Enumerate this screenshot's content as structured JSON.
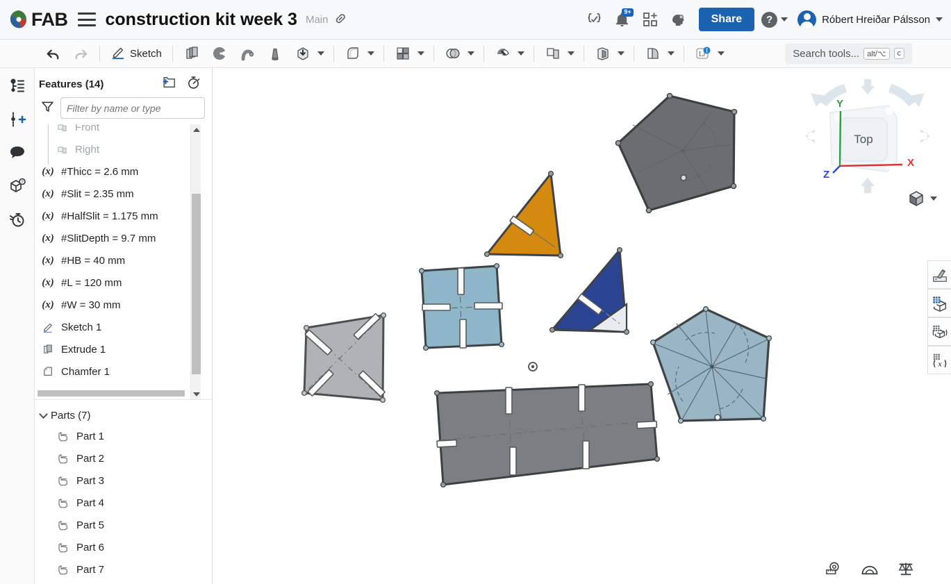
{
  "header": {
    "logo_text": "FAB",
    "logo_icon": "fab-logo-icon",
    "menu_icon": "hamburger-menu-icon",
    "document_title": "construction kit week 3",
    "branch": "Main",
    "link_icon": "link-icon",
    "icons": [
      {
        "name": "feature-script-icon",
        "glyph": "{✓}"
      },
      {
        "name": "notifications-bell-icon",
        "glyph": "🔔",
        "badge": "9+"
      },
      {
        "name": "apps-grid-icon",
        "glyph": "grid-plus"
      },
      {
        "name": "learning-center-icon",
        "glyph": "brain"
      }
    ],
    "share_label": "Share",
    "help_icon": "help-question-icon",
    "help_caret_icon": "chevron-down-icon",
    "avatar_icon": "user-avatar",
    "user_name": "Róbert Hreiðar Pálsson",
    "user_caret_icon": "chevron-down-icon"
  },
  "toolbar": {
    "undo_icon": "undo-arrow-icon",
    "redo_icon": "redo-arrow-icon",
    "sketch_label": "Sketch",
    "sketch_icon": "pencil-sketch-icon",
    "tools": [
      {
        "name": "extrude-icon",
        "caret": false
      },
      {
        "name": "revolve-icon",
        "caret": false
      },
      {
        "name": "sweep-icon",
        "caret": false
      },
      {
        "name": "loft-icon",
        "caret": false
      },
      {
        "name": "thicken-icon",
        "caret": true
      },
      {
        "name": "fillet-icon",
        "caret": true
      },
      {
        "name": "pattern-icon",
        "caret": true
      },
      {
        "name": "boolean-icon",
        "caret": true
      },
      {
        "name": "draft-icon",
        "caret": true
      },
      {
        "name": "plane-icon",
        "caret": true
      },
      {
        "name": "shell-icon",
        "caret": true
      },
      {
        "name": "sheet-metal-icon",
        "caret": true
      },
      {
        "name": "variable-studio-icon",
        "caret": true
      }
    ],
    "search_placeholder": "Search tools...",
    "shortcut_alt": "alt/⌥",
    "shortcut_key": "c"
  },
  "rail": {
    "items": [
      {
        "name": "feature-list-icon"
      },
      {
        "name": "add-variable-icon"
      },
      {
        "name": "comments-icon"
      },
      {
        "name": "versions-icon"
      },
      {
        "name": "history-icon"
      }
    ]
  },
  "panel": {
    "features_title": "Features (14)",
    "new_folder_icon": "new-folder-icon",
    "rollback_icon": "rollback-stopwatch-icon",
    "filter_icon": "funnel-filter-icon",
    "filter_placeholder": "Filter by name or type",
    "filter_value": "",
    "features": [
      {
        "label": "Front",
        "icon": "plane-icon",
        "dim": true
      },
      {
        "label": "Right",
        "icon": "plane-icon",
        "dim": true
      },
      {
        "label": "#Thicc = 2.6 mm",
        "icon": "variable-icon",
        "dim": false
      },
      {
        "label": "#Slit = 2.35 mm",
        "icon": "variable-icon",
        "dim": false
      },
      {
        "label": "#HalfSlit = 1.175 mm",
        "icon": "variable-icon",
        "dim": false
      },
      {
        "label": "#SlitDepth = 9.7 mm",
        "icon": "variable-icon",
        "dim": false
      },
      {
        "label": "#HB = 40 mm",
        "icon": "variable-icon",
        "dim": false
      },
      {
        "label": "#L = 120 mm",
        "icon": "variable-icon",
        "dim": false
      },
      {
        "label": "#W = 30 mm",
        "icon": "variable-icon",
        "dim": false
      },
      {
        "label": "Sketch 1",
        "icon": "sketch-icon",
        "dim": false
      },
      {
        "label": "Extrude 1",
        "icon": "extrude-icon",
        "dim": false
      },
      {
        "label": "Chamfer 1",
        "icon": "chamfer-icon",
        "dim": false
      }
    ],
    "parts_title": "Parts (7)",
    "parts": [
      {
        "label": "Part 1",
        "icon": "part-icon"
      },
      {
        "label": "Part 2",
        "icon": "part-icon"
      },
      {
        "label": "Part 3",
        "icon": "part-icon"
      },
      {
        "label": "Part 4",
        "icon": "part-icon"
      },
      {
        "label": "Part 5",
        "icon": "part-icon"
      },
      {
        "label": "Part 6",
        "icon": "part-icon"
      },
      {
        "label": "Part 7",
        "icon": "part-icon"
      }
    ],
    "filter_toggle_icon": "filter-list-toggle-icon"
  },
  "viewport": {
    "viewcube_face": "Top",
    "axis_x": "X",
    "axis_y": "Y",
    "axis_z": "Z",
    "axis_x_color": "#e03131",
    "axis_y_color": "#2f9e44",
    "axis_z_color": "#2b47d6",
    "origin_marker": "origin-point",
    "view_dropdown_icon": "view-style-cube-icon",
    "parts_geometry": [
      {
        "name": "pentagon-dark-gray",
        "color": "#6b6e71"
      },
      {
        "name": "triangle-orange",
        "color": "#d4890f"
      },
      {
        "name": "square-light-blue",
        "color": "#8fb5c9"
      },
      {
        "name": "triangle-blue",
        "color": "#2b4491"
      },
      {
        "name": "square-light-gray",
        "color": "#b0b2b4"
      },
      {
        "name": "pentagon-light-blue",
        "color": "#9ab6c4"
      },
      {
        "name": "rectangle-gray",
        "color": "#7c7f82"
      }
    ],
    "right_tools": [
      {
        "name": "appearance-icon"
      },
      {
        "name": "display-state-icon"
      },
      {
        "name": "configuration-icon"
      },
      {
        "name": "variable-studio-panel-icon"
      }
    ],
    "bottom_tools": [
      {
        "name": "measure-tape-icon"
      },
      {
        "name": "protractor-icon"
      },
      {
        "name": "mass-properties-icon"
      }
    ]
  }
}
